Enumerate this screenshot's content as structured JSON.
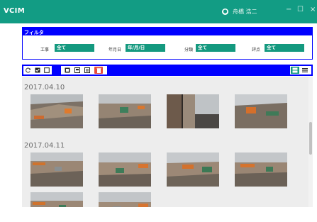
{
  "app": {
    "title": "VCIM",
    "user_name": "舟橋 浩二",
    "window_buttons": [
      "−",
      "☐",
      "×"
    ]
  },
  "filter": {
    "title": "フィルタ",
    "fields": [
      {
        "label": "工事",
        "value": "全て"
      },
      {
        "label": "年月日",
        "value": "年/月/日"
      },
      {
        "label": "分類",
        "value": "全て"
      },
      {
        "label": "評点",
        "value": "全て"
      }
    ]
  },
  "toolbar": {
    "left_buttons": [
      "refresh-icon",
      "check-all-icon",
      "uncheck-icon",
      "view-photo-icon",
      "view-comment-icon",
      "view-detail-icon",
      "delete-icon"
    ],
    "right_buttons": [
      "grid-view-icon",
      "list-view-icon"
    ],
    "colors": {
      "accent": "#0000ff",
      "selected": "#14997f",
      "danger": "#e74c3c"
    }
  },
  "gallery": {
    "groups": [
      {
        "date": "2017.04.10",
        "photo_count": 4
      },
      {
        "date": "2017.04.11",
        "photo_count": 6
      }
    ]
  }
}
